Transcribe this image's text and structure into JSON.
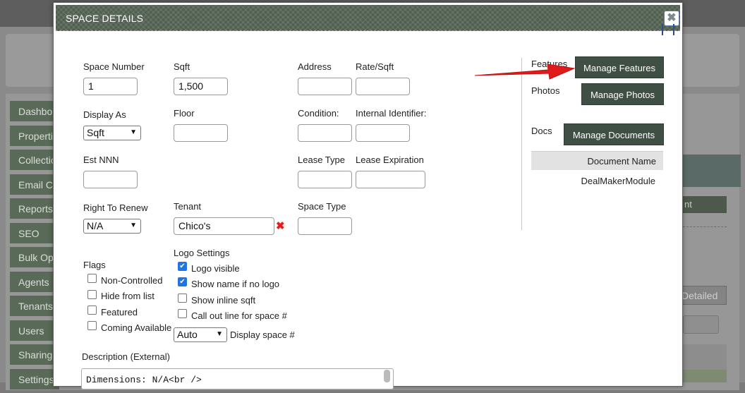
{
  "background": {
    "sidebar_items": [
      "Dashbo",
      "Properti",
      "Collectio",
      "Email C",
      "Reports",
      "SEO",
      "Bulk Op",
      "Agents",
      "Tenants",
      "Users",
      "Sharing",
      "Settings"
    ],
    "right_button_1": "nt",
    "right_button_2": "Detailed"
  },
  "dialog": {
    "title": "SPACE DETAILS",
    "close_glyph": "✖"
  },
  "form": {
    "space_number": {
      "label": "Space Number",
      "value": "1"
    },
    "sqft": {
      "label": "Sqft",
      "value": "1,500"
    },
    "address": {
      "label": "Address",
      "value": ""
    },
    "rate_sqft": {
      "label": "Rate/Sqft",
      "value": ""
    },
    "display_as": {
      "label": "Display As",
      "value": "Sqft"
    },
    "floor": {
      "label": "Floor",
      "value": ""
    },
    "condition": {
      "label": "Condition:",
      "value": ""
    },
    "internal_identifier": {
      "label": "Internal Identifier:",
      "value": ""
    },
    "est_nnn": {
      "label": "Est NNN",
      "value": ""
    },
    "lease_type": {
      "label": "Lease Type",
      "value": ""
    },
    "lease_expiration": {
      "label": "Lease Expiration",
      "value": ""
    },
    "right_to_renew": {
      "label": "Right To Renew",
      "value": "N/A"
    },
    "tenant": {
      "label": "Tenant",
      "value": "Chico's"
    },
    "space_type": {
      "label": "Space Type",
      "value": ""
    },
    "flags": {
      "label": "Flags",
      "items": [
        {
          "label": "Non-Controlled",
          "checked": false
        },
        {
          "label": "Hide from list",
          "checked": false
        },
        {
          "label": "Featured",
          "checked": false
        },
        {
          "label": "Coming Available",
          "checked": false
        }
      ]
    },
    "logo_settings": {
      "label": "Logo Settings",
      "items": [
        {
          "label": "Logo visible",
          "checked": true
        },
        {
          "label": "Show name if no logo",
          "checked": true
        },
        {
          "label": "Show inline sqft",
          "checked": false
        },
        {
          "label": "Call out line for space #",
          "checked": false
        }
      ],
      "display_space_select": "Auto",
      "display_space_label": "Display space #"
    },
    "description": {
      "label": "Description (External)",
      "value": "Dimensions: N/A<br />"
    }
  },
  "sidebar": {
    "features_label": "Features",
    "manage_features": "Manage Features",
    "photos_label": "Photos",
    "manage_photos": "Manage Photos",
    "docs_label": "Docs",
    "manage_documents": "Manage Documents",
    "doc_table_header": "Document Name",
    "doc_rows": [
      "DealMakerModule"
    ]
  },
  "colors": {
    "header": "#4f5e4f",
    "dark_button": "#3f4f44",
    "arrow": "#e01b1b",
    "checkbox_on": "#2174e8"
  }
}
